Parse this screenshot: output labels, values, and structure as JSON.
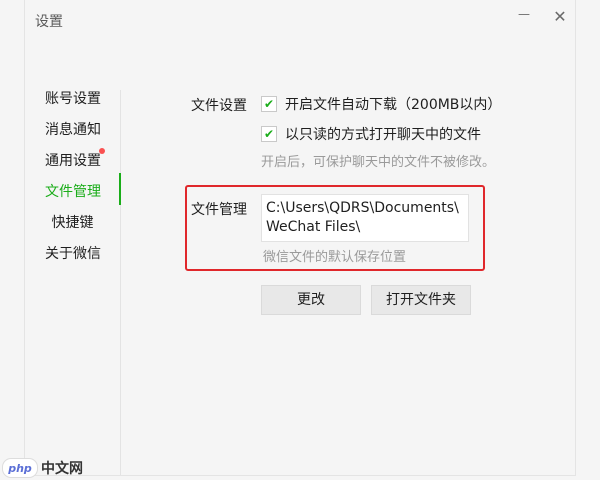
{
  "window": {
    "title": "设置",
    "min_icon": "minimize-icon",
    "close_icon": "close-icon"
  },
  "sidebar": {
    "items": [
      {
        "label": "账号设置"
      },
      {
        "label": "消息通知"
      },
      {
        "label": "通用设置",
        "badge": "red-dot"
      },
      {
        "label": "文件管理",
        "active": true
      },
      {
        "label": "快捷键"
      },
      {
        "label": "关于微信"
      }
    ]
  },
  "file_settings": {
    "section_label": "文件设置",
    "auto_download": {
      "label": "开启文件自动下载（200MB以内）",
      "checked": true
    },
    "read_only": {
      "label": "以只读的方式打开聊天中的文件",
      "checked": true
    },
    "hint": "开启后，可保护聊天中的文件不被修改。"
  },
  "file_management": {
    "section_label": "文件管理",
    "path_line1": "C:\\Users\\QDRS\\Documents\\",
    "path_line2": "WeChat Files\\",
    "path_hint": "微信文件的默认保存位置",
    "change_button": "更改",
    "open_folder_button": "打开文件夹"
  },
  "colors": {
    "accent": "#1aad19",
    "highlight": "#e0272b",
    "badge": "#fa5151"
  },
  "watermark": {
    "logo": "php",
    "text": "中文网"
  }
}
